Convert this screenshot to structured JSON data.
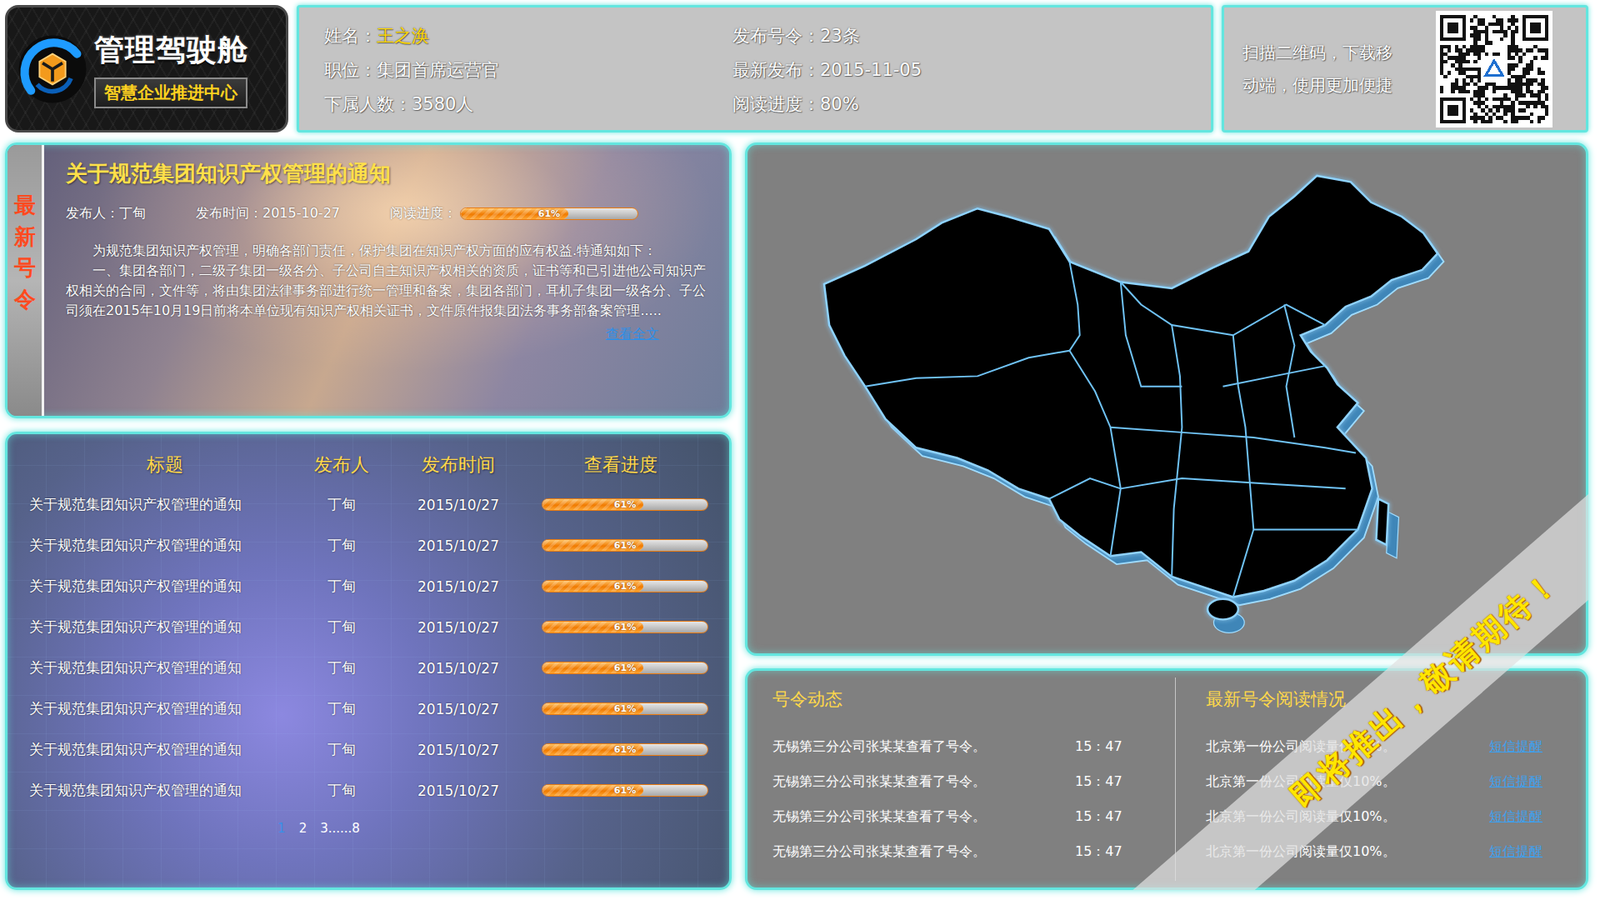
{
  "logo": {
    "title": "管理驾驶舱",
    "subtitle": "智慧企业推进中心"
  },
  "profile": {
    "fields": [
      {
        "label": "姓名：",
        "value": "王之涣",
        "highlight": true
      },
      {
        "label": "职位：",
        "value": "集团首席运营官",
        "highlight": false
      },
      {
        "label": "下属人数：",
        "value": "3580人",
        "highlight": false
      },
      {
        "label": "发布号令：",
        "value": "23条",
        "highlight": false
      },
      {
        "label": "最新发布：",
        "value": "2015-11-05",
        "highlight": false
      },
      {
        "label": "阅读进度：",
        "value": "80%",
        "highlight": false
      }
    ]
  },
  "qr": {
    "text": "扫描二维码，下载移动端，使用更加便捷"
  },
  "latest": {
    "side_label": "最新号令",
    "title": "关于规范集团知识产权管理的通知",
    "publisher_label": "发布人：",
    "publisher": "丁甸",
    "time_label": "发布时间：",
    "time": "2015-10-27",
    "progress_label": "阅读进度：",
    "level": 0.61,
    "reading": "61%",
    "body": [
      "为规范集团知识产权管理，明确各部门责任，保护集团在知识产权方面的应有权益.特通知如下：",
      "一、集团各部门，二级子集团一级各分、子公司自主知识产权相关的资质，证书等和已引进他公司知识产权相关的合同，文件等，将由集团法律事务部进行统一管理和备案，集团各部门，耳机子集团一级各分、子公司须在2015年10月19日前将本单位现有知识产权相关证书，文件原件报集团法务事务部备案管理....."
    ],
    "link": "查看全文"
  },
  "table": {
    "columns": [
      "标题",
      "发布人",
      "发布时间",
      "查看进度"
    ],
    "rows": [
      {
        "title": "关于规范集团知识产权管理的通知",
        "publisher": "丁甸",
        "date": "2015/10/27",
        "level": 0.61,
        "reading": "61%"
      },
      {
        "title": "关于规范集团知识产权管理的通知",
        "publisher": "丁甸",
        "date": "2015/10/27",
        "level": 0.61,
        "reading": "61%"
      },
      {
        "title": "关于规范集团知识产权管理的通知",
        "publisher": "丁甸",
        "date": "2015/10/27",
        "level": 0.61,
        "reading": "61%"
      },
      {
        "title": "关于规范集团知识产权管理的通知",
        "publisher": "丁甸",
        "date": "2015/10/27",
        "level": 0.61,
        "reading": "61%"
      },
      {
        "title": "关于规范集团知识产权管理的通知",
        "publisher": "丁甸",
        "date": "2015/10/27",
        "level": 0.61,
        "reading": "61%"
      },
      {
        "title": "关于规范集团知识产权管理的通知",
        "publisher": "丁甸",
        "date": "2015/10/27",
        "level": 0.61,
        "reading": "61%"
      },
      {
        "title": "关于规范集团知识产权管理的通知",
        "publisher": "丁甸",
        "date": "2015/10/27",
        "level": 0.61,
        "reading": "61%"
      },
      {
        "title": "关于规范集团知识产权管理的通知",
        "publisher": "丁甸",
        "date": "2015/10/27",
        "level": 0.61,
        "reading": "61%"
      }
    ],
    "pages": [
      {
        "label": "1",
        "selected": true
      },
      {
        "label": "2",
        "selected": false
      },
      {
        "label": "3......8",
        "selected": false
      }
    ]
  },
  "activity": {
    "title": "号令动态",
    "items": [
      {
        "text": "无锡第三分公司张某某查看了号令。",
        "time": "15：47"
      },
      {
        "text": "无锡第三分公司张某某查看了号令。",
        "time": "15：47"
      },
      {
        "text": "无锡第三分公司张某某查看了号令。",
        "time": "15：47"
      },
      {
        "text": "无锡第三分公司张某某查看了号令。",
        "time": "15：47"
      }
    ]
  },
  "reading": {
    "title": "最新号令阅读情况",
    "items": [
      {
        "text": "北京第一份公司阅读量仅10%。",
        "action": "短信提醒"
      },
      {
        "text": "北京第一份公司阅读量仅10%。",
        "action": "短信提醒"
      },
      {
        "text": "北京第一份公司阅读量仅10%。",
        "action": "短信提醒"
      },
      {
        "text": "北京第一份公司阅读量仅10%。",
        "action": "短信提醒"
      }
    ]
  },
  "banner": {
    "text": "即将推出，敬请期待！"
  }
}
